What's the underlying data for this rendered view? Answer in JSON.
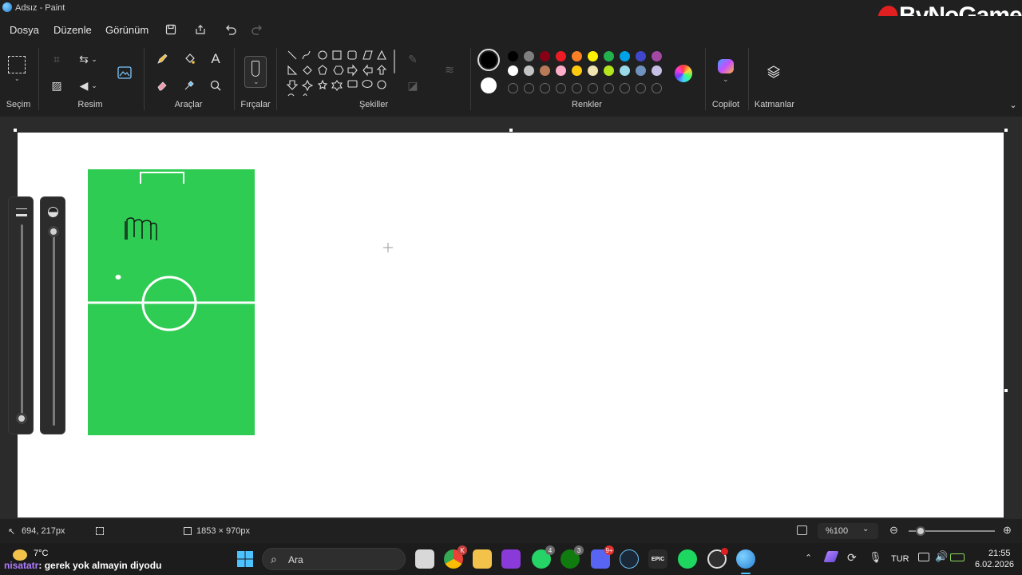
{
  "window": {
    "title": "Adsız - Paint"
  },
  "watermark": {
    "text": "ByNoGame"
  },
  "menu": {
    "file": "Dosya",
    "edit": "Düzenle",
    "view": "Görünüm"
  },
  "ribbon": {
    "selection_label": "Seçim",
    "image_label": "Resim",
    "tools_label": "Araçlar",
    "brushes_label": "Fırçalar",
    "shapes_label": "Şekiller",
    "colors_label": "Renkler",
    "copilot_label": "Copilot",
    "layers_label": "Katmanlar",
    "text_tool_glyph": "A"
  },
  "colors": {
    "primary": "#000000",
    "secondary": "#ffffff",
    "palette_row1": [
      "#000000",
      "#7f7f7f",
      "#880015",
      "#ed1c24",
      "#ff7f27",
      "#fff200",
      "#22b14c",
      "#00a2e8",
      "#3f48cc",
      "#a349a4"
    ],
    "palette_row2": [
      "#ffffff",
      "#c3c3c3",
      "#b97a57",
      "#ffaec9",
      "#ffc90e",
      "#efe4b0",
      "#b5e61d",
      "#99d9ea",
      "#7092be",
      "#c8bfe7"
    ],
    "custom_empty_count": 10,
    "accent": "#2ecc52"
  },
  "canvas": {
    "field_color": "#2ecc52"
  },
  "status": {
    "cursor_pos": "694, 217px",
    "canvas_size": "1853 × 970px",
    "zoom": "%100"
  },
  "taskbar": {
    "weather_temp": "7°C",
    "chat_user": "nisatatr",
    "chat_message": "gerek yok almayin diyodu",
    "search_placeholder": "Ara",
    "language": "TUR",
    "time": "21:55",
    "date": "6.02.2026",
    "badges": {
      "chrome": "K",
      "whatsapp": "4",
      "xbox": "3",
      "discord": "9+"
    },
    "epic_label": "EPIC"
  }
}
